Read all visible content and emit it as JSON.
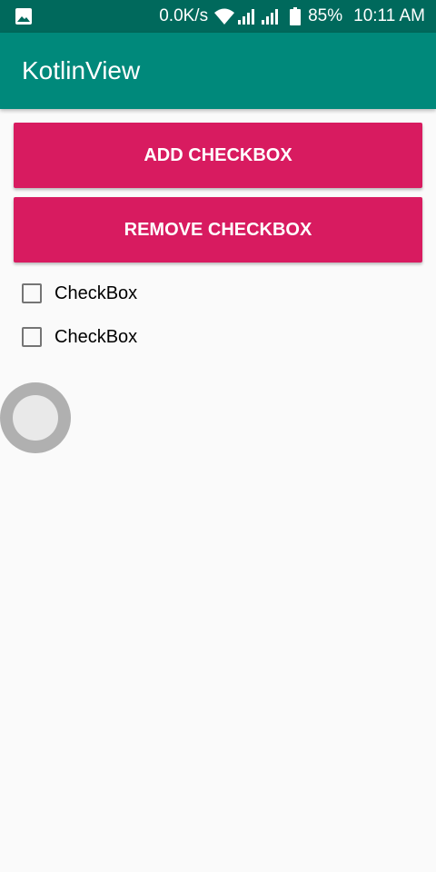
{
  "status_bar": {
    "net_speed": "0.0K/s",
    "battery_percent": "85%",
    "time": "10:11 AM",
    "icons": [
      "image-notification-icon",
      "wifi-icon",
      "signal-icon",
      "signal-icon",
      "battery-icon"
    ]
  },
  "app_bar": {
    "title": "KotlinView",
    "color": "#00897b"
  },
  "buttons": {
    "add_label": "ADD CHECKBOX",
    "remove_label": "REMOVE CHECKBOX",
    "color": "#d81b60"
  },
  "checkboxes": [
    {
      "label": "CheckBox",
      "checked": false
    },
    {
      "label": "CheckBox",
      "checked": false
    }
  ]
}
